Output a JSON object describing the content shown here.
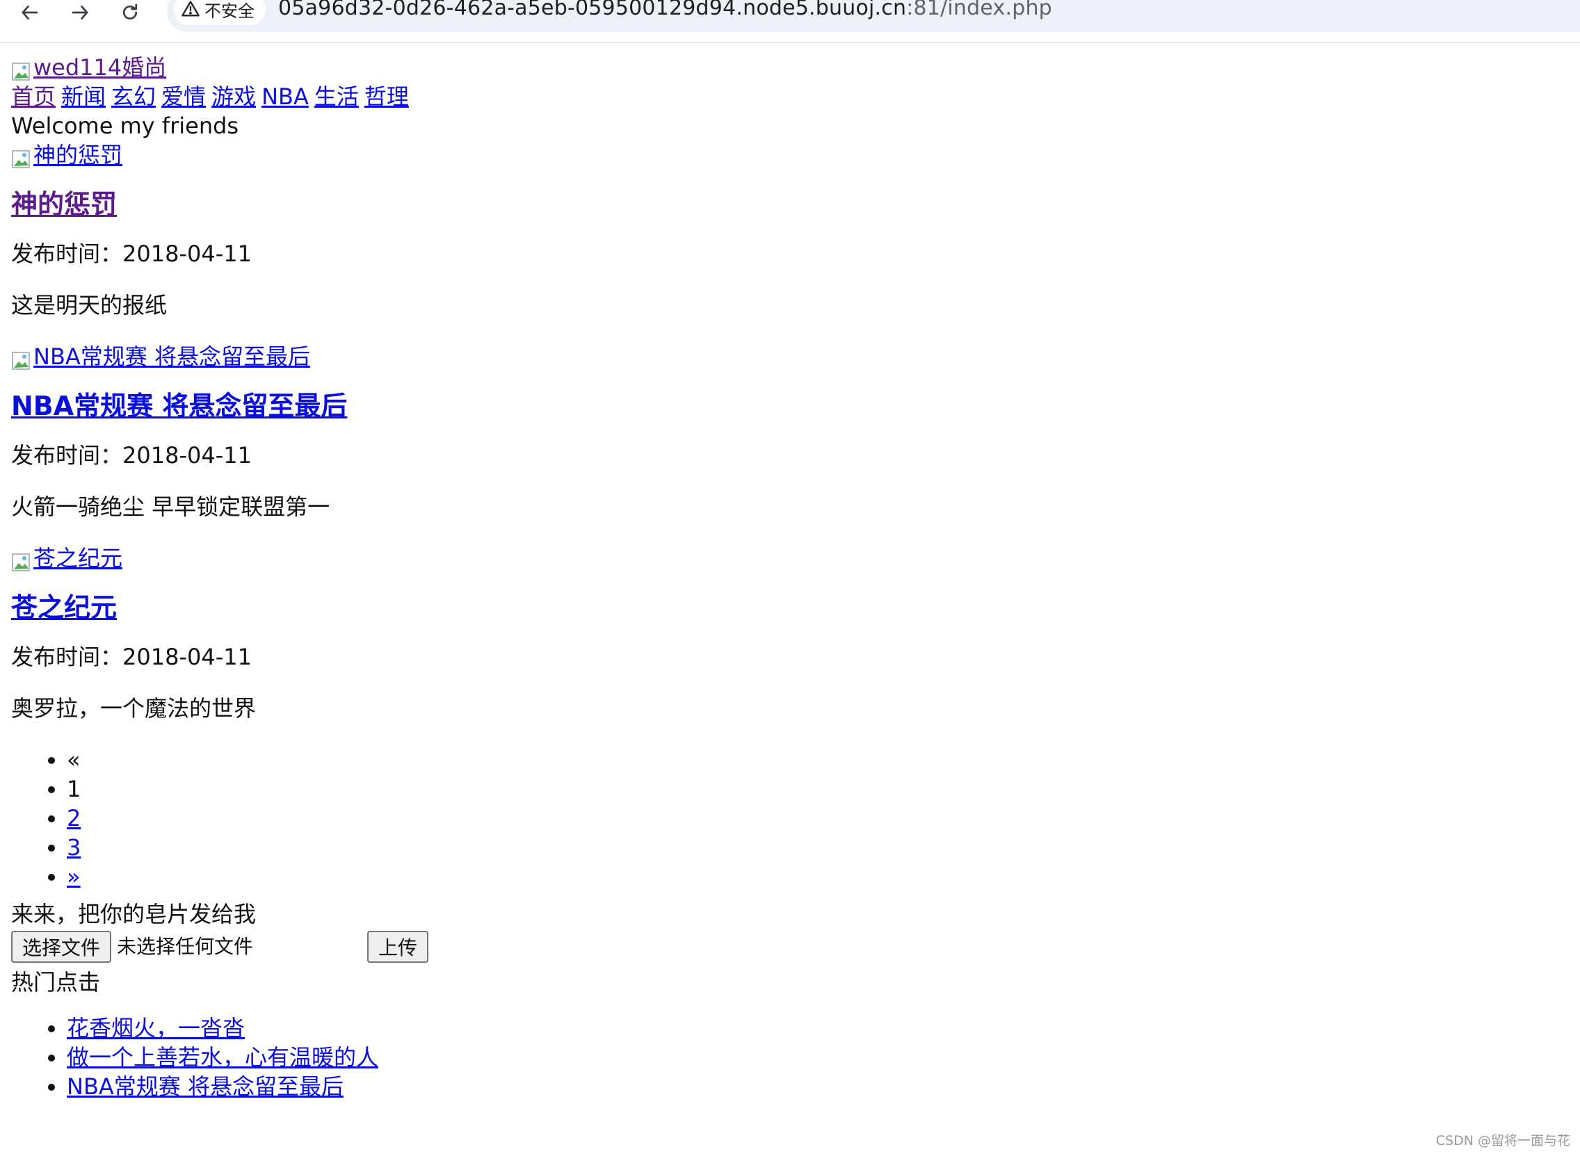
{
  "browser": {
    "security_label": "不安全",
    "url_host": "05a96d32-0d26-462a-a5eb-059500129d94.node5.buuoj.cn",
    "url_rest": ":81/index.php"
  },
  "header": {
    "logo_alt": "wed114婚尚",
    "nav": [
      "首页",
      "新闻",
      "玄幻",
      "爱情",
      "游戏",
      "NBA",
      "生活",
      "哲理"
    ],
    "welcome": "Welcome my friends"
  },
  "posts": [
    {
      "image_alt": "神的惩罚",
      "title": "神的惩罚",
      "date": "发布时间：2018-04-11",
      "summary": "这是明天的报纸"
    },
    {
      "image_alt": "NBA常规赛 将悬念留至最后",
      "title": "NBA常规赛 将悬念留至最后",
      "date": "发布时间：2018-04-11",
      "summary": "火箭一骑绝尘 早早锁定联盟第一"
    },
    {
      "image_alt": "苍之纪元",
      "title": "苍之纪元",
      "date": "发布时间：2018-04-11",
      "summary": "奥罗拉，一个魔法的世界"
    }
  ],
  "pagination": {
    "prev": "«",
    "current": "1",
    "pages": [
      "2",
      "3"
    ],
    "next": "»"
  },
  "upload": {
    "prompt": "来来，把你的皂片发给我",
    "choose_label": "选择文件",
    "file_status": "未选择任何文件",
    "submit_label": "上传"
  },
  "hot": {
    "title": "热门点击",
    "items": [
      "花香烟火，一沓沓",
      "做一个上善若水，心有温暖的人",
      "NBA常规赛 将悬念留至最后"
    ]
  },
  "watermark": "CSDN @留将一面与花"
}
